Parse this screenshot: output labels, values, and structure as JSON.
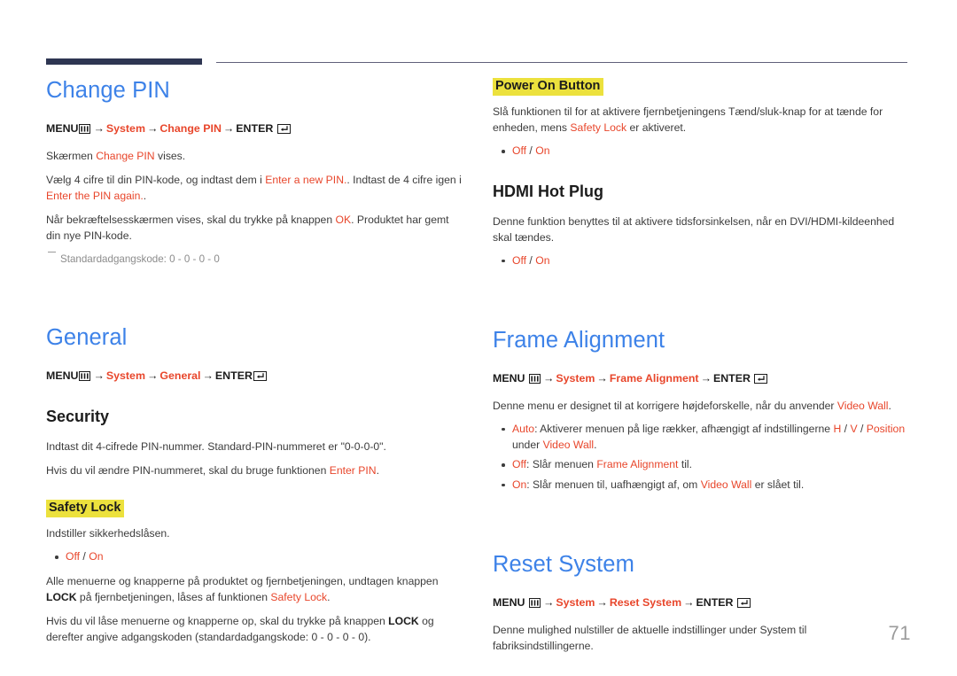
{
  "document": {
    "page_number": "71",
    "accent_color": "#e8462b",
    "heading_color": "#3d82e8",
    "highlight_color": "#ece13d",
    "rule_color": "#2e3652"
  },
  "icons": {
    "menu": "menu-icon",
    "enter": "enter-icon"
  },
  "left_column": {
    "change_pin": {
      "title": "Change PIN",
      "menu_path": {
        "menu_label": "MENU",
        "arrow": "→",
        "item1": "System",
        "item2": "Change PIN",
        "enter_label": "ENTER"
      },
      "p1_a": "Skærmen ",
      "p1_b": "Change PIN",
      "p1_c": " vises.",
      "p2_a": "Vælg 4 cifre til din PIN-kode, og indtast dem i ",
      "p2_b": "Enter a new PIN.",
      "p2_c": ". Indtast de 4 cifre igen i ",
      "p2_d": "Enter the PIN again.",
      "p2_e": ".",
      "p3_a": "Når bekræftelsesskærmen vises, skal du trykke på knappen ",
      "p3_b": "OK",
      "p3_c": ". Produktet har gemt din nye PIN-kode.",
      "note": "Standardadgangskode: 0 - 0 - 0 - 0"
    },
    "general": {
      "title": "General",
      "menu_path": {
        "menu_label": "MENU",
        "arrow": "→",
        "item1": "System",
        "item2": "General",
        "enter_label": "ENTER"
      },
      "security": {
        "title": "Security",
        "p1": "Indtast dit 4-cifrede PIN-nummer. Standard-PIN-nummeret er \"0-0-0-0\".",
        "p2_a": "Hvis du vil ændre PIN-nummeret, skal du bruge funktionen ",
        "p2_b": "Enter PIN",
        "p2_c": "."
      },
      "safety_lock": {
        "title": "Safety Lock",
        "p1": "Indstiller sikkerhedslåsen.",
        "option_off": "Off",
        "option_sep": " / ",
        "option_on": "On",
        "p2_a": "Alle menuerne og knapperne på produktet og fjernbetjeningen, undtagen knappen ",
        "p2_b": "LOCK",
        "p2_c": " på fjernbetjeningen, låses af funktionen ",
        "p2_d": "Safety Lock",
        "p2_e": ".",
        "p3_a": "Hvis du vil låse menuerne og knapperne op, skal du trykke på knappen ",
        "p3_b": "LOCK",
        "p3_c": " og derefter angive adgangskoden (standardadgangskode: 0 - 0 - 0 - 0)."
      }
    }
  },
  "right_column": {
    "power_on_button": {
      "title": "Power On Button",
      "p1_a": "Slå funktionen til for at aktivere fjernbetjeningens Tænd/sluk-knap for at tænde for enheden, mens ",
      "p1_b": "Safety Lock",
      "p1_c": " er aktiveret.",
      "option_off": "Off",
      "option_sep": " / ",
      "option_on": "On"
    },
    "hdmi_hot_plug": {
      "title": "HDMI Hot Plug",
      "p1": "Denne funktion benyttes til at aktivere tidsforsinkelsen, når en DVI/HDMI-kildeenhed skal tændes.",
      "option_off": "Off",
      "option_sep": " / ",
      "option_on": "On"
    },
    "frame_alignment": {
      "title": "Frame Alignment",
      "menu_path": {
        "menu_label": "MENU",
        "arrow": "→",
        "item1": "System",
        "item2": "Frame Alignment",
        "enter_label": "ENTER"
      },
      "p1_a": "Denne menu er designet til at korrigere højdeforskelle, når du anvender ",
      "p1_b": "Video Wall",
      "p1_c": ".",
      "b1_a": "Auto",
      "b1_b": ": Aktiverer menuen på lige rækker, afhængigt af indstillingerne ",
      "b1_c": "H",
      "b1_d": " / ",
      "b1_e": "V",
      "b1_f": " / ",
      "b1_g": "Position",
      "b1_h": " under ",
      "b1_i": "Video Wall",
      "b1_j": ".",
      "b2_a": "Off",
      "b2_b": ": Slår menuen ",
      "b2_c": "Frame Alignment",
      "b2_d": " til.",
      "b3_a": "On",
      "b3_b": ": Slår menuen til, uafhængigt af, om ",
      "b3_c": "Video Wall",
      "b3_d": " er slået til."
    },
    "reset_system": {
      "title": "Reset System",
      "menu_path": {
        "menu_label": "MENU",
        "arrow": "→",
        "item1": "System",
        "item2": "Reset System",
        "enter_label": "ENTER"
      },
      "p1": "Denne mulighed nulstiller de aktuelle indstillinger under System til fabriksindstillingerne."
    }
  }
}
